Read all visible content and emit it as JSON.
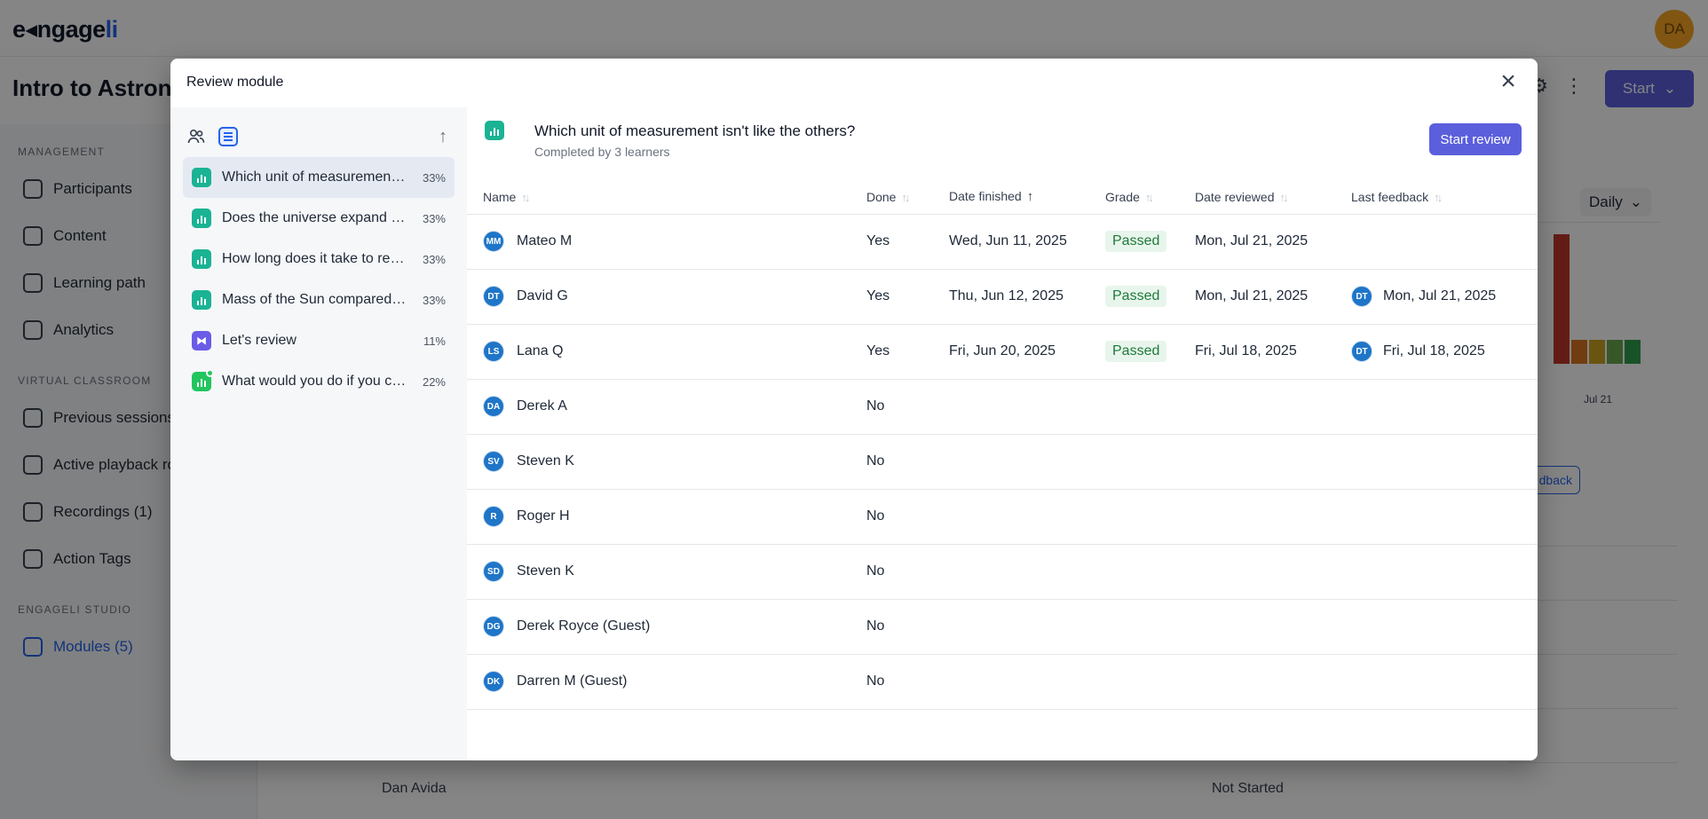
{
  "app": {
    "logo_text": "e",
    "logo_mid": "ngage",
    "logo_end": "li",
    "user_initials": "DA",
    "course_title": "Intro to Astronomy",
    "start_label": "Start"
  },
  "sidebar": {
    "sections": [
      {
        "label": "MANAGEMENT",
        "items": [
          "Participants",
          "Content",
          "Learning path",
          "Analytics"
        ]
      },
      {
        "label": "VIRTUAL CLASSROOM",
        "items": [
          "Previous sessions",
          "Active playback rooms",
          "Recordings (1)",
          "Action Tags"
        ]
      },
      {
        "label": "ENGAGELI STUDIO",
        "items": [
          "Modules (5)"
        ]
      }
    ]
  },
  "background": {
    "daily_label": "Daily",
    "chart_x_label": "Jul 21",
    "feedback_label": "dback",
    "bottom_name": "Dan Avida",
    "bottom_status": "Not Started"
  },
  "modal": {
    "title": "Review module",
    "close_glyph": "×",
    "sort_glyph": "↑",
    "modules": [
      {
        "label": "Which unit of measurement isn't like the others?",
        "pct": "33%",
        "type": "poll"
      },
      {
        "label": "Does the universe expand forever?",
        "pct": "33%",
        "type": "poll"
      },
      {
        "label": "How long does it take to reach the Moon?",
        "pct": "33%",
        "type": "poll"
      },
      {
        "label": "Mass of the Sun compared to Earth",
        "pct": "33%",
        "type": "poll"
      },
      {
        "label": "Let's review",
        "pct": "11%",
        "type": "review"
      },
      {
        "label": "What would you do if you could visit space?",
        "pct": "22%",
        "type": "poll-new"
      }
    ],
    "question": {
      "title": "Which unit of measurement isn't like the others?",
      "subtitle": "Completed by 3 learners",
      "start_review_label": "Start review"
    },
    "table": {
      "headers": {
        "name": "Name",
        "done": "Done",
        "date_finished": "Date finished",
        "grade": "Grade",
        "date_reviewed": "Date reviewed",
        "last_feedback": "Last feedback"
      },
      "rows": [
        {
          "initials": "MM",
          "name": "Mateo M",
          "done": "Yes",
          "date_finished": "Wed, Jun 11, 2025",
          "grade": "Passed",
          "date_reviewed": "Mon, Jul 21, 2025",
          "fb_initials": "",
          "last_feedback": ""
        },
        {
          "initials": "DT",
          "name": "David G",
          "done": "Yes",
          "date_finished": "Thu, Jun 12, 2025",
          "grade": "Passed",
          "date_reviewed": "Mon, Jul 21, 2025",
          "fb_initials": "DT",
          "last_feedback": "Mon, Jul 21, 2025"
        },
        {
          "initials": "LS",
          "name": "Lana Q",
          "done": "Yes",
          "date_finished": "Fri, Jun 20, 2025",
          "grade": "Passed",
          "date_reviewed": "Fri, Jul 18, 2025",
          "fb_initials": "DT",
          "last_feedback": "Fri, Jul 18, 2025"
        },
        {
          "initials": "DA",
          "name": "Derek A",
          "done": "No",
          "date_finished": "",
          "grade": "",
          "date_reviewed": "",
          "fb_initials": "",
          "last_feedback": ""
        },
        {
          "initials": "SV",
          "name": "Steven K",
          "done": "No",
          "date_finished": "",
          "grade": "",
          "date_reviewed": "",
          "fb_initials": "",
          "last_feedback": ""
        },
        {
          "initials": "R",
          "name": "Roger H",
          "done": "No",
          "date_finished": "",
          "grade": "",
          "date_reviewed": "",
          "fb_initials": "",
          "last_feedback": ""
        },
        {
          "initials": "SD",
          "name": "Steven K",
          "done": "No",
          "date_finished": "",
          "grade": "",
          "date_reviewed": "",
          "fb_initials": "",
          "last_feedback": ""
        },
        {
          "initials": "DG",
          "name": "Derek Royce (Guest)",
          "done": "No",
          "date_finished": "",
          "grade": "",
          "date_reviewed": "",
          "fb_initials": "",
          "last_feedback": ""
        },
        {
          "initials": "DK",
          "name": "Darren M (Guest)",
          "done": "No",
          "date_finished": "",
          "grade": "",
          "date_reviewed": "",
          "fb_initials": "",
          "last_feedback": ""
        }
      ]
    }
  },
  "colors": {
    "accent": "#5b5fdc",
    "avatar": "#1f75c7",
    "passed_bg": "#e8f5ec",
    "passed_text": "#1f7a3a",
    "poll_icon": "#1ab394"
  }
}
